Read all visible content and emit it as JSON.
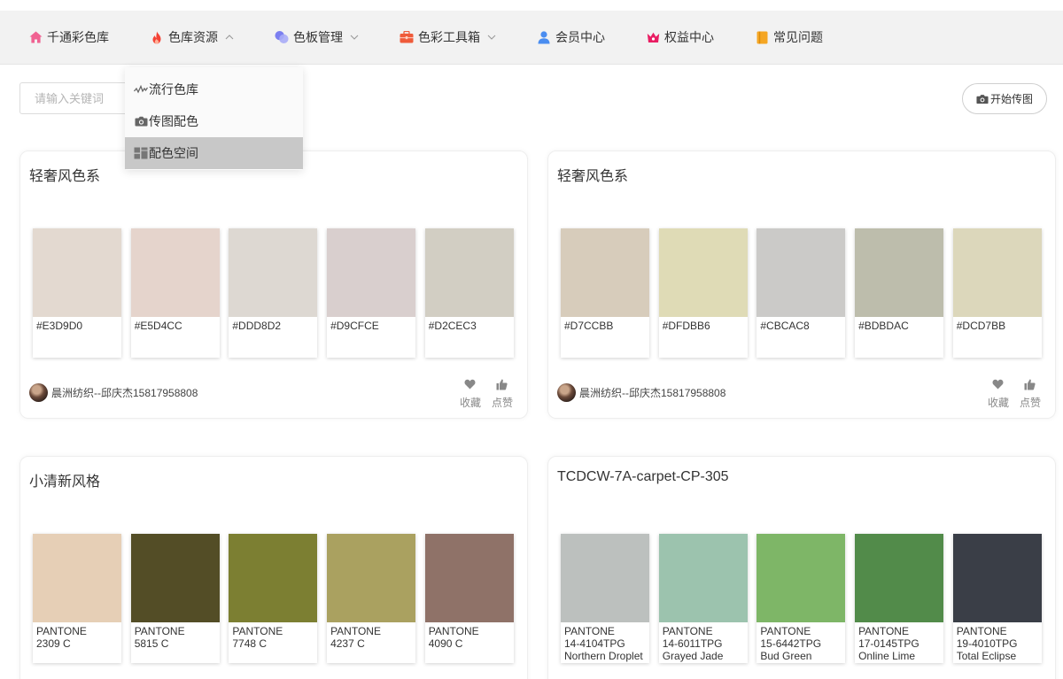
{
  "nav": {
    "items": [
      {
        "label": "千通彩色库",
        "icon": "home-icon",
        "color": "#f06292"
      },
      {
        "label": "色库资源",
        "icon": "fire-icon",
        "color": "#f44336",
        "chevron": "up"
      },
      {
        "label": "色板管理",
        "icon": "palette-icon",
        "color": "#7b7ff0",
        "chevron": "down"
      },
      {
        "label": "色彩工具箱",
        "icon": "toolbox-icon",
        "color": "#ef5b3a",
        "chevron": "down"
      },
      {
        "label": "会员中心",
        "icon": "user-icon",
        "color": "#4a8df0"
      },
      {
        "label": "权益中心",
        "icon": "crown-icon",
        "color": "#e91e63"
      },
      {
        "label": "常见问题",
        "icon": "faq-book-icon",
        "color": "#f5a623"
      }
    ]
  },
  "dropdown": {
    "items": [
      {
        "label": "流行色库",
        "icon": "trend-icon"
      },
      {
        "label": "传图配色",
        "icon": "camera-icon"
      },
      {
        "label": "配色空间",
        "icon": "grid-icon",
        "active": true
      }
    ]
  },
  "search": {
    "placeholder": "请输入关键词"
  },
  "upload": {
    "label": "开始传图",
    "icon": "camera-icon"
  },
  "actions": {
    "collect": "收藏",
    "like": "点赞"
  },
  "cards": [
    {
      "title": "轻奢风色系",
      "author": "晨洲纺织--邱庆杰15817958808",
      "swatches": [
        {
          "hex": "#E3D9D0",
          "lines": [
            "#E3D9D0"
          ]
        },
        {
          "hex": "#E5D4CC",
          "lines": [
            "#E5D4CC"
          ]
        },
        {
          "hex": "#DDD8D2",
          "lines": [
            "#DDD8D2"
          ]
        },
        {
          "hex": "#D9CFCE",
          "lines": [
            "#D9CFCE"
          ]
        },
        {
          "hex": "#D2CEC3",
          "lines": [
            "#D2CEC3"
          ]
        }
      ]
    },
    {
      "title": "轻奢风色系",
      "author": "晨洲纺织--邱庆杰15817958808",
      "swatches": [
        {
          "hex": "#D7CCBB",
          "lines": [
            "#D7CCBB"
          ]
        },
        {
          "hex": "#DFDBB6",
          "lines": [
            "#DFDBB6"
          ]
        },
        {
          "hex": "#CBCAC8",
          "lines": [
            "#CBCAC8"
          ]
        },
        {
          "hex": "#BDBDAC",
          "lines": [
            "#BDBDAC"
          ]
        },
        {
          "hex": "#DCD7BB",
          "lines": [
            "#DCD7BB"
          ]
        }
      ]
    },
    {
      "title": "小清新风格",
      "swatches": [
        {
          "hex": "#E6CFB6",
          "lines": [
            "PANTONE",
            "2309 C"
          ]
        },
        {
          "hex": "#534D26",
          "lines": [
            "PANTONE",
            "5815 C"
          ]
        },
        {
          "hex": "#7C7F32",
          "lines": [
            "PANTONE",
            "7748 C"
          ]
        },
        {
          "hex": "#AAA160",
          "lines": [
            "PANTONE",
            "4237 C"
          ]
        },
        {
          "hex": "#8F7268",
          "lines": [
            "PANTONE",
            "4090 C"
          ]
        }
      ]
    },
    {
      "title": "TCDCW-7A-carpet-CP-305",
      "swatches": [
        {
          "hex": "#BCC0BE",
          "lines": [
            "PANTONE",
            "14-4104TPG",
            "Northern Droplet"
          ]
        },
        {
          "hex": "#9CC3AE",
          "lines": [
            "PANTONE",
            "14-6011TPG",
            "Grayed Jade"
          ]
        },
        {
          "hex": "#7EB667",
          "lines": [
            "PANTONE",
            "15-6442TPG",
            "Bud Green"
          ]
        },
        {
          "hex": "#528B4A",
          "lines": [
            "PANTONE",
            "17-0145TPG",
            "Online Lime"
          ]
        },
        {
          "hex": "#3A3E47",
          "lines": [
            "PANTONE",
            "19-4010TPG",
            "Total Eclipse"
          ]
        }
      ]
    }
  ]
}
